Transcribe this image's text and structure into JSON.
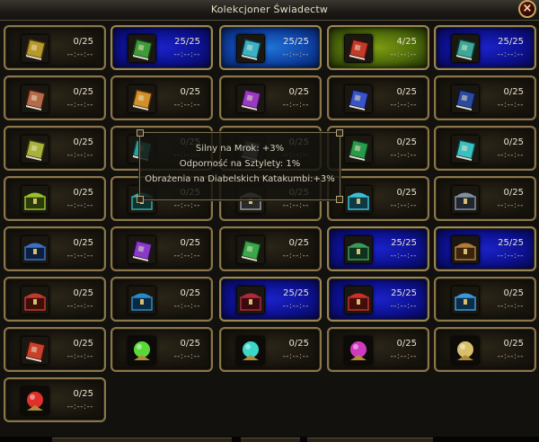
{
  "window": {
    "title": "Kolekcjoner Świadectw",
    "close_icon": "close-x-icon"
  },
  "tooltip": {
    "lines": [
      "Silny na Mrok: +3%",
      "Odporność na Sztylety: 1%",
      "Obrażenia na Diabelskich Katakumbi:+3%"
    ]
  },
  "colors": {
    "frame_gold": "#8a7648",
    "blue_bg": "#0d1190",
    "green_bg": "#4c6a0a",
    "cyan_bg": "#1f73d6"
  },
  "slots": [
    {
      "count": "0/25",
      "timer": "--:--:--",
      "bg": "dark",
      "icon": "book-gold-icon",
      "c1": "#b89a2a",
      "c2": "#4a3a0e"
    },
    {
      "count": "25/25",
      "timer": "--:--:--",
      "bg": "blue",
      "icon": "book-green-icon",
      "c1": "#3f9a3a",
      "c2": "#123d13"
    },
    {
      "count": "25/25",
      "timer": "--:--:--",
      "bg": "cyan",
      "icon": "book-cyan-icon",
      "c1": "#39b2c8",
      "c2": "#0d3f4a"
    },
    {
      "count": "4/25",
      "timer": "--:--:--",
      "bg": "green",
      "icon": "book-red-icon",
      "c1": "#c23a2a",
      "c2": "#4a0e0a"
    },
    {
      "count": "25/25",
      "timer": "--:--:--",
      "bg": "blue",
      "icon": "book-teal-icon",
      "c1": "#3aa89a",
      "c2": "#0e3a35"
    },
    {
      "count": "0/25",
      "timer": "--:--:--",
      "bg": "dark",
      "icon": "book-brown-icon",
      "c1": "#b56a4a",
      "c2": "#3f1d10"
    },
    {
      "count": "0/25",
      "timer": "--:--:--",
      "bg": "dark",
      "icon": "book-orange-icon",
      "c1": "#d0902a",
      "c2": "#4a2a08"
    },
    {
      "count": "0/25",
      "timer": "--:--:--",
      "bg": "dark",
      "icon": "book-purple-icon",
      "c1": "#9a3ac0",
      "c2": "#2f0d40"
    },
    {
      "count": "0/25",
      "timer": "--:--:--",
      "bg": "dark",
      "icon": "book-blue-icon",
      "c1": "#3a54c8",
      "c2": "#0e1748"
    },
    {
      "count": "0/25",
      "timer": "--:--:--",
      "bg": "dark",
      "icon": "book-navy-icon",
      "c1": "#2a4aa0",
      "c2": "#0a1438"
    },
    {
      "count": "0/25",
      "timer": "--:--:--",
      "bg": "dark",
      "icon": "book-olive-icon",
      "c1": "#a8b23a",
      "c2": "#36390e"
    },
    {
      "count": "0/25",
      "timer": "--:--:--",
      "bg": "dark",
      "icon": "book-teal-icon",
      "c1": "#2aa09a",
      "c2": "#0a3432"
    },
    {
      "count": "0/25",
      "timer": "--:--:--",
      "bg": "dark",
      "icon": "book-slate-icon",
      "c1": "#6a7480",
      "c2": "#1c2026"
    },
    {
      "count": "0/25",
      "timer": "--:--:--",
      "bg": "dark",
      "icon": "book-green-icon",
      "c1": "#2a9a4a",
      "c2": "#0a3416"
    },
    {
      "count": "0/25",
      "timer": "--:--:--",
      "bg": "dark",
      "icon": "book-cyan-icon",
      "c1": "#3ac0c0",
      "c2": "#0d3f40"
    },
    {
      "count": "0/25",
      "timer": "--:--:--",
      "bg": "dark",
      "icon": "chest-lime-icon",
      "c1": "#9ac02a",
      "c2": "#2a3a08"
    },
    {
      "count": "0/25",
      "timer": "--:--:--",
      "bg": "dark",
      "icon": "chest-teal-icon",
      "c1": "#3aa8a0",
      "c2": "#0d3330"
    },
    {
      "count": "0/25",
      "timer": "--:--:--",
      "bg": "dark",
      "icon": "chest-grey-icon",
      "c1": "#9a9a9a",
      "c2": "#2a2a2a"
    },
    {
      "count": "0/25",
      "timer": "--:--:--",
      "bg": "dark",
      "icon": "chest-cyan-icon",
      "c1": "#3ac0d8",
      "c2": "#0d3a44"
    },
    {
      "count": "0/25",
      "timer": "--:--:--",
      "bg": "dark",
      "icon": "chest-steel-icon",
      "c1": "#8090a0",
      "c2": "#20262c"
    },
    {
      "count": "0/25",
      "timer": "--:--:--",
      "bg": "dark",
      "icon": "chest-blue-icon",
      "c1": "#3a70c8",
      "c2": "#0d1f3f"
    },
    {
      "count": "0/25",
      "timer": "--:--:--",
      "bg": "dark",
      "icon": "book-violet-icon",
      "c1": "#8a3ac8",
      "c2": "#2a0d44"
    },
    {
      "count": "0/25",
      "timer": "--:--:--",
      "bg": "dark",
      "icon": "book-green-icon",
      "c1": "#3aa84a",
      "c2": "#0d3a14"
    },
    {
      "count": "25/25",
      "timer": "--:--:--",
      "bg": "blue",
      "icon": "chest-green-icon",
      "c1": "#3a9a5a",
      "c2": "#0d3320"
    },
    {
      "count": "25/25",
      "timer": "--:--:--",
      "bg": "blue",
      "icon": "chest-bronze-icon",
      "c1": "#b07a3a",
      "c2": "#3a240c"
    },
    {
      "count": "0/25",
      "timer": "--:--:--",
      "bg": "dark",
      "icon": "chest-red-icon",
      "c1": "#c03a2a",
      "c2": "#400e0a"
    },
    {
      "count": "0/25",
      "timer": "--:--:--",
      "bg": "dark",
      "icon": "chest-azure-icon",
      "c1": "#2a8ac8",
      "c2": "#0a2a44"
    },
    {
      "count": "25/25",
      "timer": "--:--:--",
      "bg": "blue",
      "icon": "chest-crimson-icon",
      "c1": "#b02a3a",
      "c2": "#3a0a10"
    },
    {
      "count": "25/25",
      "timer": "--:--:--",
      "bg": "blue",
      "icon": "chest-scarlet-icon",
      "c1": "#c8302a",
      "c2": "#440c0a"
    },
    {
      "count": "0/25",
      "timer": "--:--:--",
      "bg": "dark",
      "icon": "chest-sky-icon",
      "c1": "#3a9ad8",
      "c2": "#0d2c48"
    },
    {
      "count": "0/25",
      "timer": "--:--:--",
      "bg": "dark",
      "icon": "book-red-icon",
      "c1": "#c8402a",
      "c2": "#440f0a"
    },
    {
      "count": "0/25",
      "timer": "--:--:--",
      "bg": "dark",
      "icon": "orb-green-icon",
      "c1": "#5ad83a",
      "c2": "#13400d"
    },
    {
      "count": "0/25",
      "timer": "--:--:--",
      "bg": "dark",
      "icon": "orb-cyan-icon",
      "c1": "#3ad8c8",
      "c2": "#0d403a"
    },
    {
      "count": "0/25",
      "timer": "--:--:--",
      "bg": "dark",
      "icon": "orb-magenta-icon",
      "c1": "#d03ac0",
      "c2": "#400d3a"
    },
    {
      "count": "0/25",
      "timer": "--:--:--",
      "bg": "dark",
      "icon": "orb-gold-icon",
      "c1": "#d8c06a",
      "c2": "#3f3414"
    },
    {
      "count": "0/25",
      "timer": "--:--:--",
      "bg": "dark",
      "icon": "orb-red-icon",
      "c1": "#e0302a",
      "c2": "#440a08"
    }
  ]
}
